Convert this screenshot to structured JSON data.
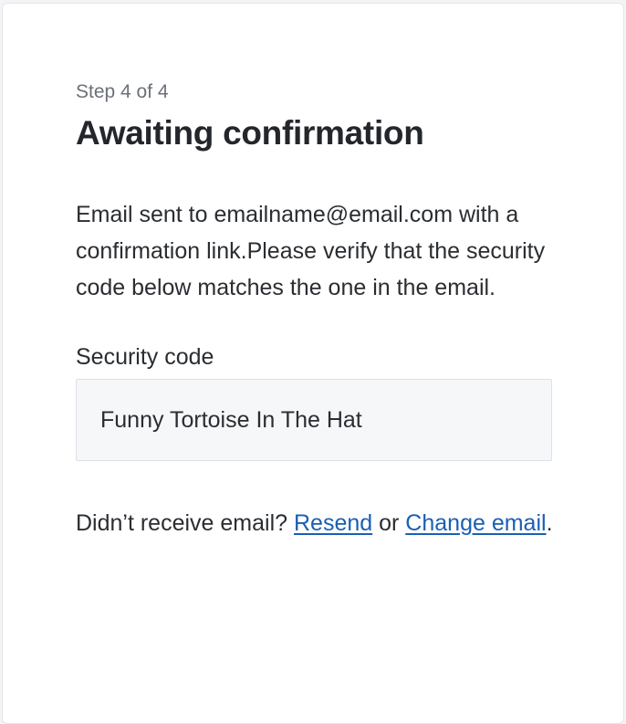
{
  "step": "Step 4 of 4",
  "title": "Awaiting confirmation",
  "message": "Email sent to emailname@email.com with a confirmation link.Please verify that the security code below matches the one in the email.",
  "security_code": {
    "label": "Security code",
    "value": "Funny Tortoise In The Hat"
  },
  "footer": {
    "prompt": "Didn’t receive email? ",
    "resend_link": "Resend",
    "or_text": " or ",
    "change_email_link": "Change email",
    "end_punct": "."
  },
  "colors": {
    "link": "#1a5fb4",
    "text": "#2a2d31",
    "muted": "#6b7178",
    "code_bg": "#f6f7f9"
  }
}
